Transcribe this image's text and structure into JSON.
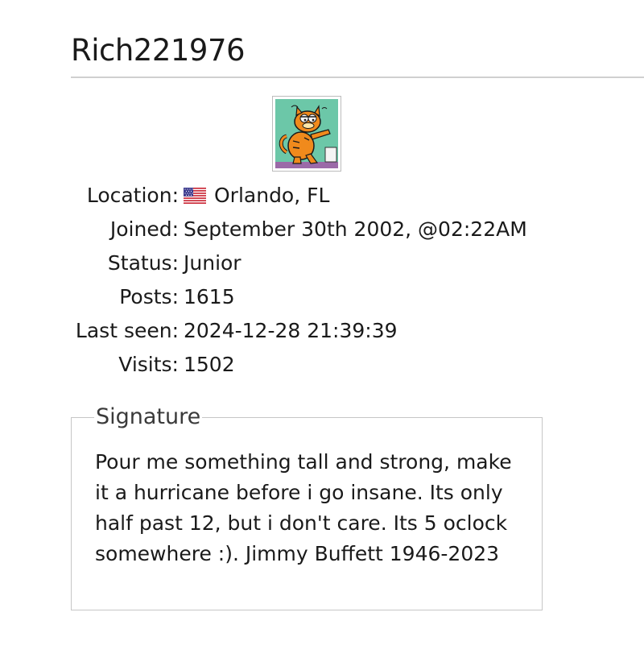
{
  "profile": {
    "username": "Rich221976",
    "avatar_icon": "garfield-avatar-icon",
    "fields": {
      "location": {
        "label": "Location:",
        "value": "Orlando, FL",
        "flag_icon": "us-flag-icon"
      },
      "joined": {
        "label": "Joined:",
        "value": "September 30th 2002, @02:22AM"
      },
      "status": {
        "label": "Status:",
        "value": "Junior"
      },
      "posts": {
        "label": "Posts:",
        "value": "1615"
      },
      "last_seen": {
        "label": "Last seen:",
        "value": "2024-12-28 21:39:39"
      },
      "visits": {
        "label": "Visits:",
        "value": "1502"
      }
    }
  },
  "signature": {
    "legend": "Signature",
    "text": "Pour me something tall and strong, make it a hurricane before i go insane. Its only half past 12, but i don't care. Its 5 oclock somewhere :). Jimmy Buffett 1946-2023"
  },
  "colors": {
    "avatar_background": "#6cc7a8",
    "avatar_floor": "#9b6aa8",
    "garfield_orange": "#f08a1c"
  }
}
